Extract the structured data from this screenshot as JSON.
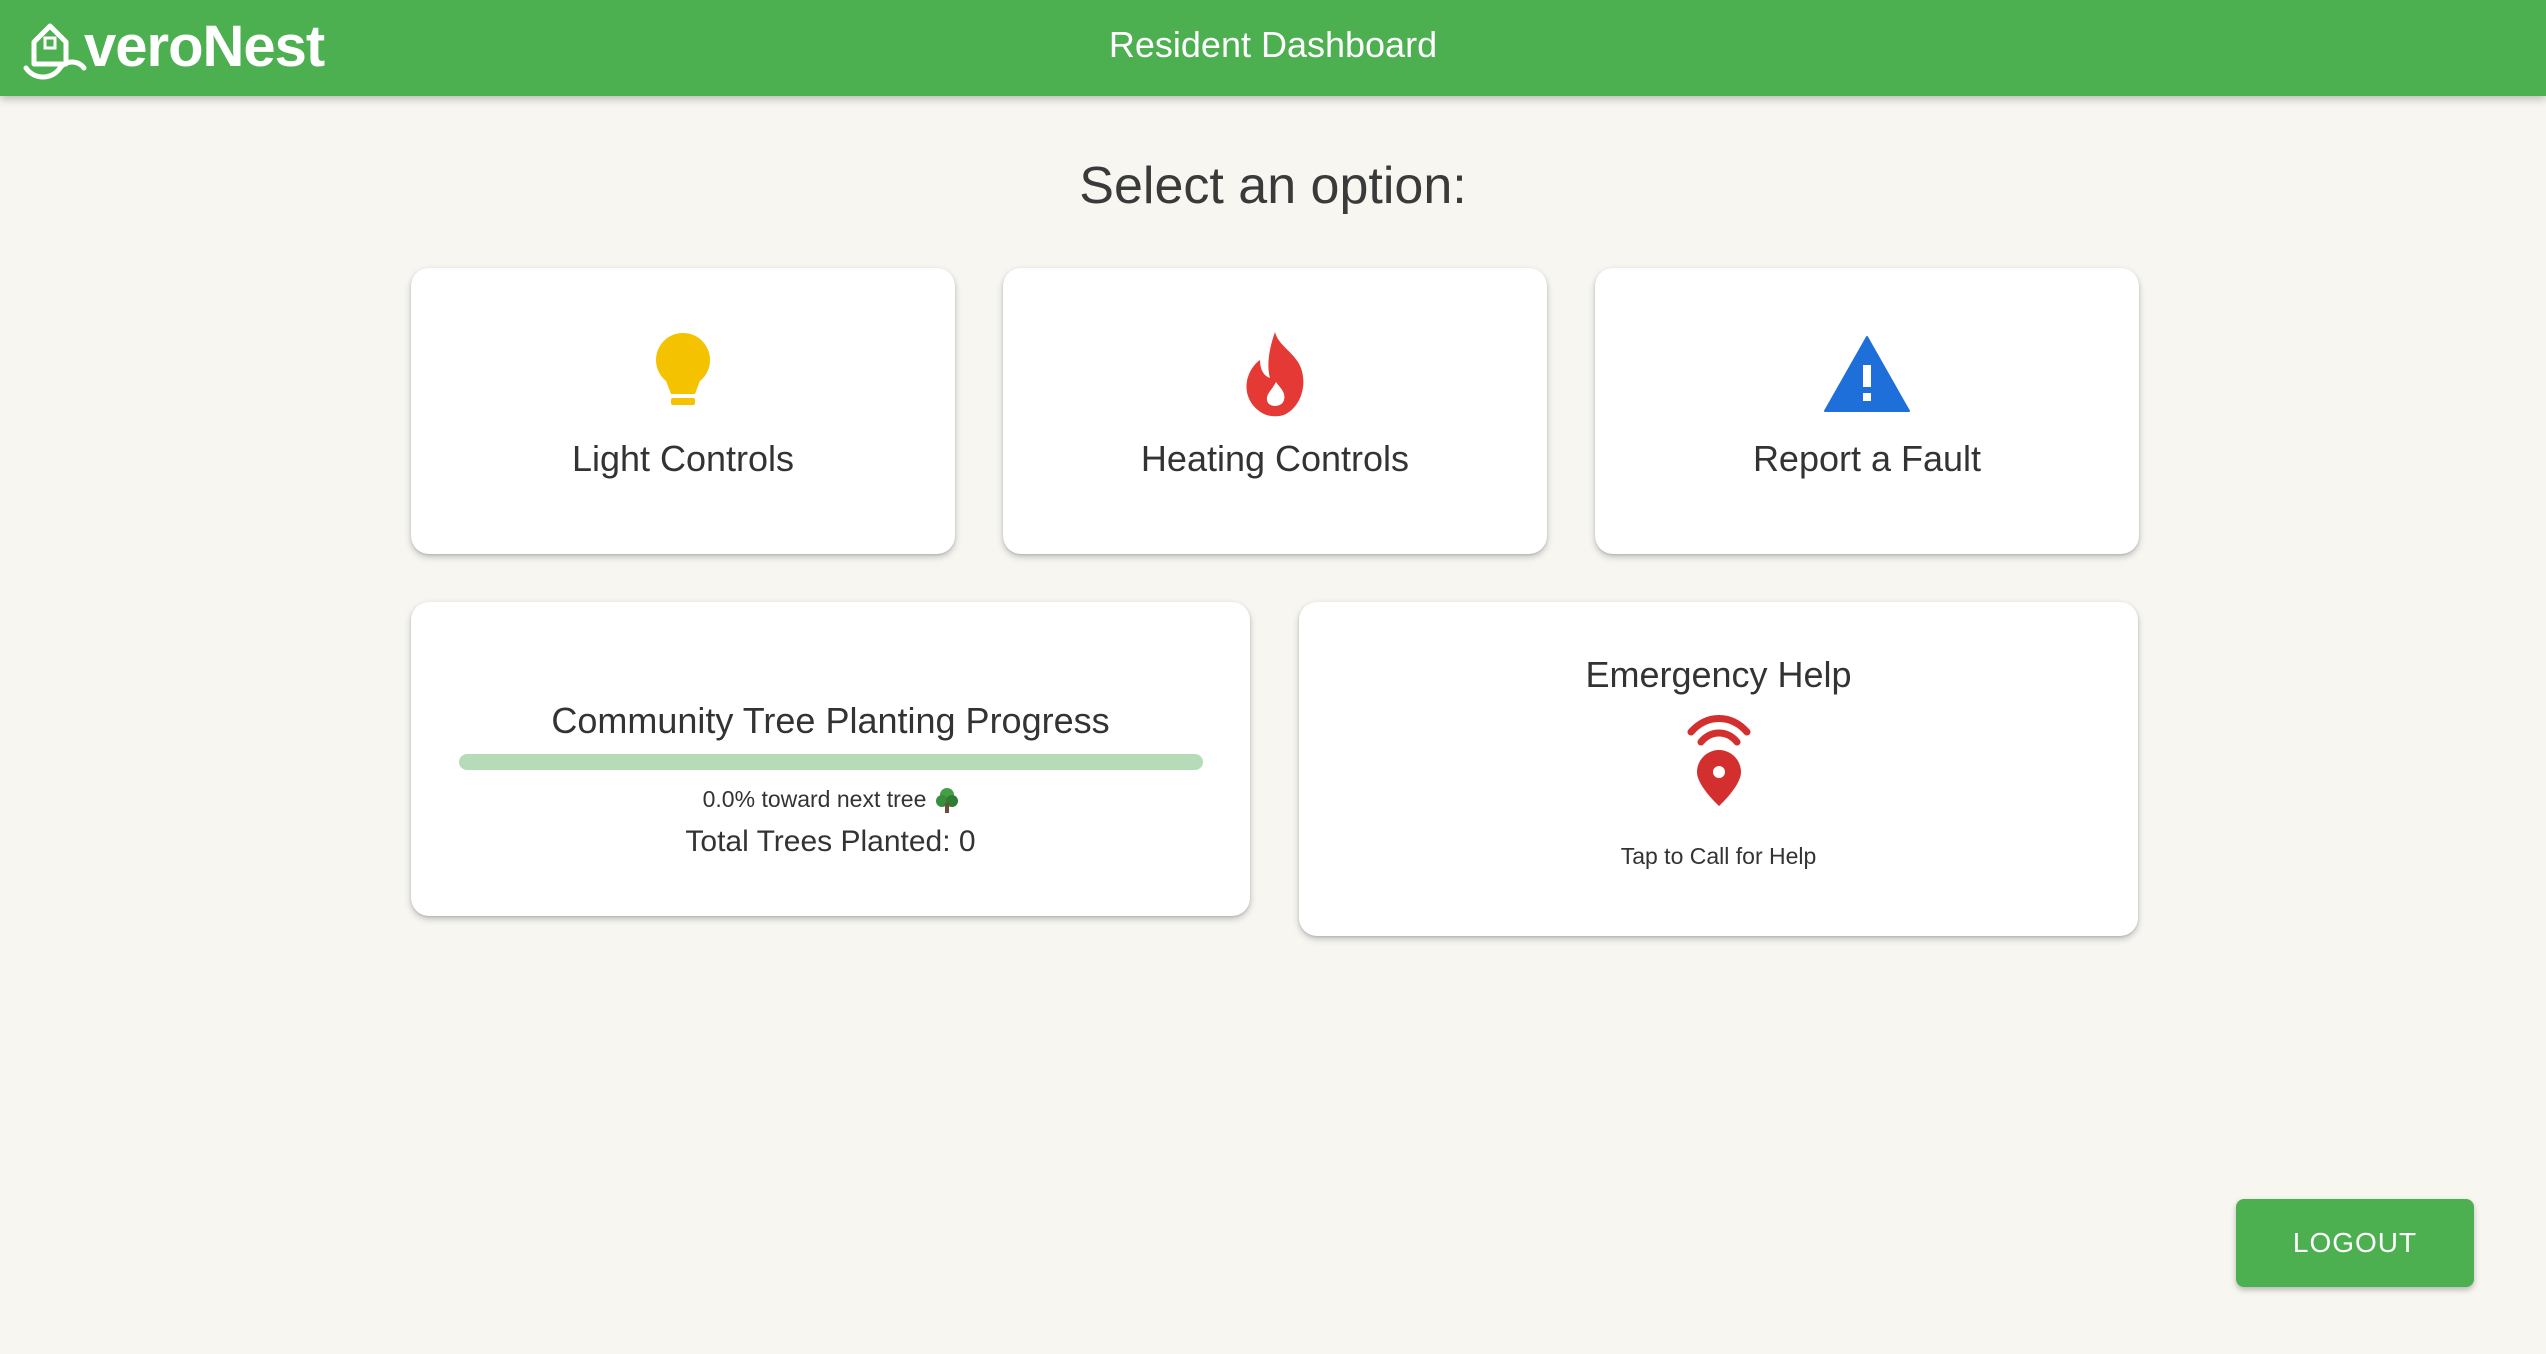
{
  "header": {
    "logo_text": "veroNest",
    "title": "Resident Dashboard"
  },
  "main": {
    "heading": "Select an option:",
    "options": [
      {
        "label": "Light Controls",
        "icon": "lightbulb-icon",
        "icon_color": "#f5c200"
      },
      {
        "label": "Heating Controls",
        "icon": "flame-icon",
        "icon_color": "#e53935"
      },
      {
        "label": "Report a Fault",
        "icon": "warning-icon",
        "icon_color": "#1e6fd9"
      }
    ],
    "tree_progress": {
      "title": "Community Tree Planting Progress",
      "progress": 0.0,
      "progress_text": "0.0% toward next tree",
      "total_text": "Total Trees Planted: 0"
    },
    "emergency": {
      "title": "Emergency Help",
      "icon": "location-signal-icon",
      "icon_color": "#d32f2f",
      "subtitle": "Tap to Call for Help"
    }
  },
  "footer": {
    "logout_label": "LOGOUT"
  },
  "colors": {
    "primary": "#4caf50",
    "background": "#f7f6f1",
    "progress_track": "#b5dcb7"
  }
}
